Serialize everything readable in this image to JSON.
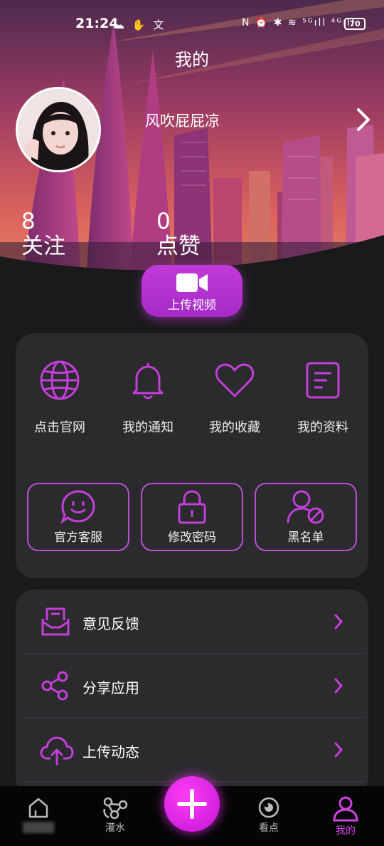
{
  "status_bar": {
    "time": "21:24",
    "left_icons": "☁ ✋ 文",
    "right_icons": "N ⏰ ✱ ≋ ⁵ᴳıll ⁴ᴳıll",
    "battery": "70"
  },
  "header": {
    "title": "我的"
  },
  "profile": {
    "username": "风吹屁屁凉",
    "avatar_icon": "avatar-photo",
    "chevron_icon": "chevron-right-icon"
  },
  "stats": {
    "follow": {
      "value": "8",
      "label": "关注"
    },
    "likes": {
      "value": "0",
      "label": "点赞"
    }
  },
  "upload_video": {
    "label": "上传视频",
    "icon": "video-camera-icon"
  },
  "quick_actions": [
    {
      "label": "点击官网",
      "icon": "globe-icon"
    },
    {
      "label": "我的通知",
      "icon": "bell-icon"
    },
    {
      "label": "我的收藏",
      "icon": "heart-icon"
    },
    {
      "label": "我的资料",
      "icon": "document-icon"
    }
  ],
  "tiles": [
    {
      "label": "官方客服",
      "icon": "smile-chat-icon"
    },
    {
      "label": "修改密码",
      "icon": "lock-icon"
    },
    {
      "label": "黑名单",
      "icon": "block-user-icon"
    }
  ],
  "list": [
    {
      "label": "意见反馈",
      "icon": "feedback-icon"
    },
    {
      "label": "分享应用",
      "icon": "share-icon"
    },
    {
      "label": "上传动态",
      "icon": "cloud-upload-icon"
    }
  ],
  "nav": {
    "items": [
      {
        "label": "",
        "icon": "home-icon"
      },
      {
        "label": "灌水",
        "icon": "nodes-icon"
      },
      {
        "label": "看点",
        "icon": "eye-icon"
      },
      {
        "label": "我的",
        "icon": "user-icon"
      }
    ],
    "active_index": 3,
    "center_icon": "plus-icon"
  },
  "colors": {
    "accent": "#c23ad7",
    "accent_bright": "#ff3df5",
    "card_bg": "#2b2a2d",
    "page_bg": "#1a1a1c"
  }
}
